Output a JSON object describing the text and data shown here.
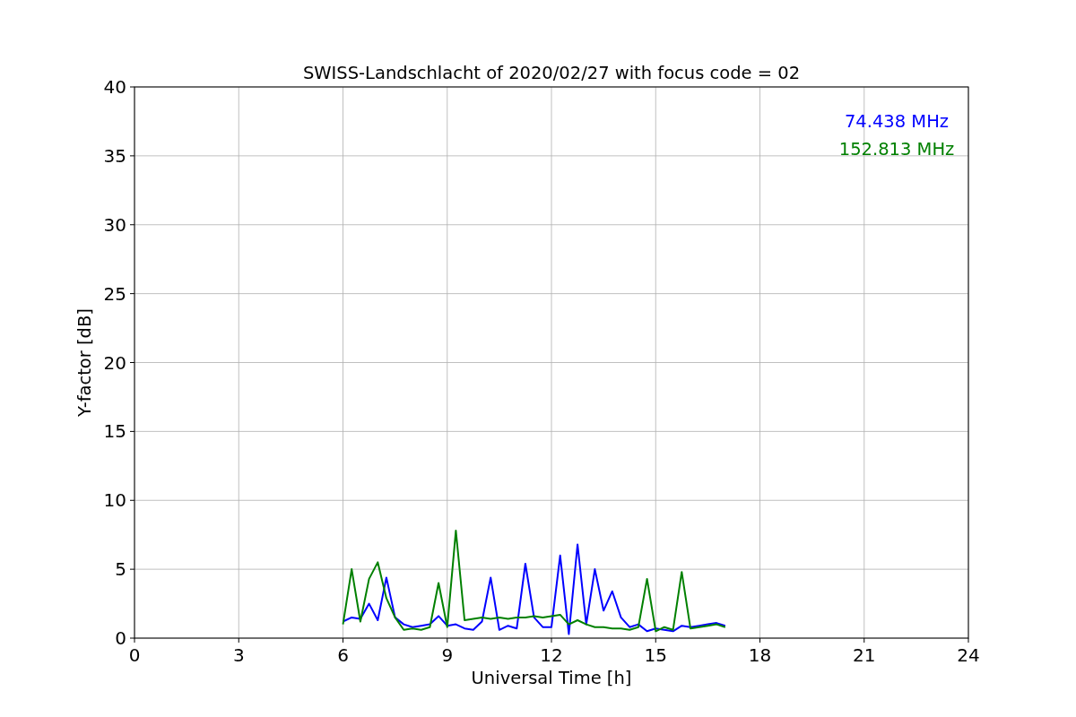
{
  "chart_data": {
    "type": "line",
    "title": "SWISS-Landschlacht of 2020/02/27 with focus code = 02",
    "xlabel": "Universal Time [h]",
    "ylabel": "Y-factor [dB]",
    "x": [
      6,
      6.25,
      6.5,
      6.75,
      7,
      7.25,
      7.5,
      7.75,
      8,
      8.25,
      8.5,
      8.75,
      9,
      9.25,
      9.5,
      9.75,
      10,
      10.25,
      10.5,
      10.75,
      11,
      11.25,
      11.5,
      11.75,
      12,
      12.25,
      12.5,
      12.75,
      13,
      13.25,
      13.5,
      13.75,
      14,
      14.25,
      14.5,
      14.75,
      15,
      15.25,
      15.5,
      15.75,
      16,
      16.25,
      16.5,
      16.75,
      17
    ],
    "series": [
      {
        "name": "74.438 MHz",
        "color": "#0000ff",
        "values": [
          1.2,
          1.5,
          1.4,
          2.5,
          1.3,
          4.4,
          1.5,
          1.0,
          0.8,
          0.9,
          1.0,
          1.6,
          0.9,
          1.0,
          0.7,
          0.6,
          1.2,
          4.4,
          0.6,
          0.9,
          0.7,
          5.4,
          1.5,
          0.8,
          0.8,
          6.0,
          0.3,
          6.8,
          1.0,
          5.0,
          2.0,
          3.4,
          1.5,
          0.8,
          1.0,
          0.5,
          0.7,
          0.6,
          0.5,
          0.9,
          0.8,
          0.9,
          1.0,
          1.1,
          0.9
        ]
      },
      {
        "name": "152.813 MHz",
        "color": "#008000",
        "values": [
          1.0,
          5.0,
          1.2,
          4.3,
          5.5,
          2.9,
          1.5,
          0.6,
          0.7,
          0.6,
          0.8,
          4.0,
          0.8,
          7.8,
          1.3,
          1.4,
          1.5,
          1.4,
          1.5,
          1.4,
          1.5,
          1.5,
          1.6,
          1.5,
          1.6,
          1.7,
          1.0,
          1.3,
          1.0,
          0.8,
          0.8,
          0.7,
          0.7,
          0.6,
          0.8,
          4.3,
          0.5,
          0.8,
          0.6,
          4.8,
          0.7,
          0.8,
          0.9,
          1.0,
          0.8
        ]
      }
    ],
    "grid": true,
    "xlim": [
      0,
      24
    ],
    "ylim": [
      0,
      40
    ],
    "xticks": [
      0,
      3,
      6,
      9,
      12,
      15,
      18,
      21,
      24
    ],
    "yticks": [
      0,
      5,
      10,
      15,
      20,
      25,
      30,
      35,
      40
    ]
  }
}
